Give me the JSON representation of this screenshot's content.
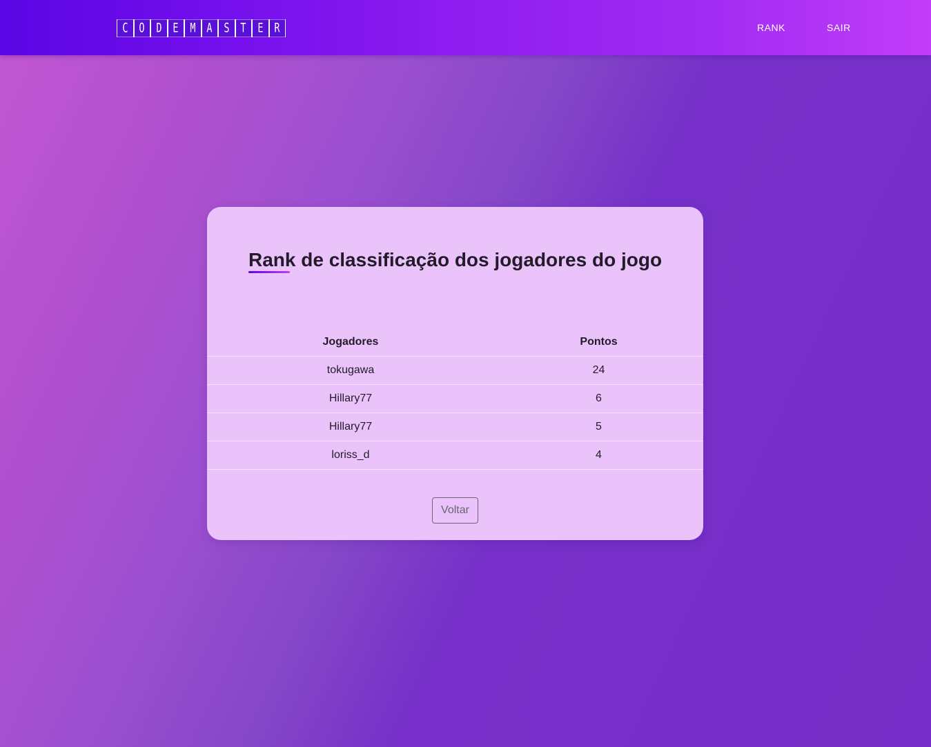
{
  "navbar": {
    "logo_letters": [
      "C",
      "O",
      "D",
      "E",
      "M",
      "A",
      "S",
      "T",
      "E",
      "R"
    ],
    "links": [
      {
        "label": "RANK"
      },
      {
        "label": "SAIR"
      }
    ]
  },
  "card": {
    "title": "Rank de classificação dos jogadores do jogo",
    "table": {
      "headers": [
        "Jogadores",
        "Pontos"
      ],
      "rows": [
        {
          "player": "tokugawa",
          "points": "24"
        },
        {
          "player": "Hillary77",
          "points": "6"
        },
        {
          "player": "Hillary77",
          "points": "5"
        },
        {
          "player": "loriss_d",
          "points": "4"
        }
      ]
    },
    "back_button_label": "Voltar"
  },
  "colors": {
    "navbar_start": "#5a05e4",
    "navbar_end": "#c23cf9",
    "card_background": "#e9c3fa",
    "text_dark": "#231a2a"
  }
}
